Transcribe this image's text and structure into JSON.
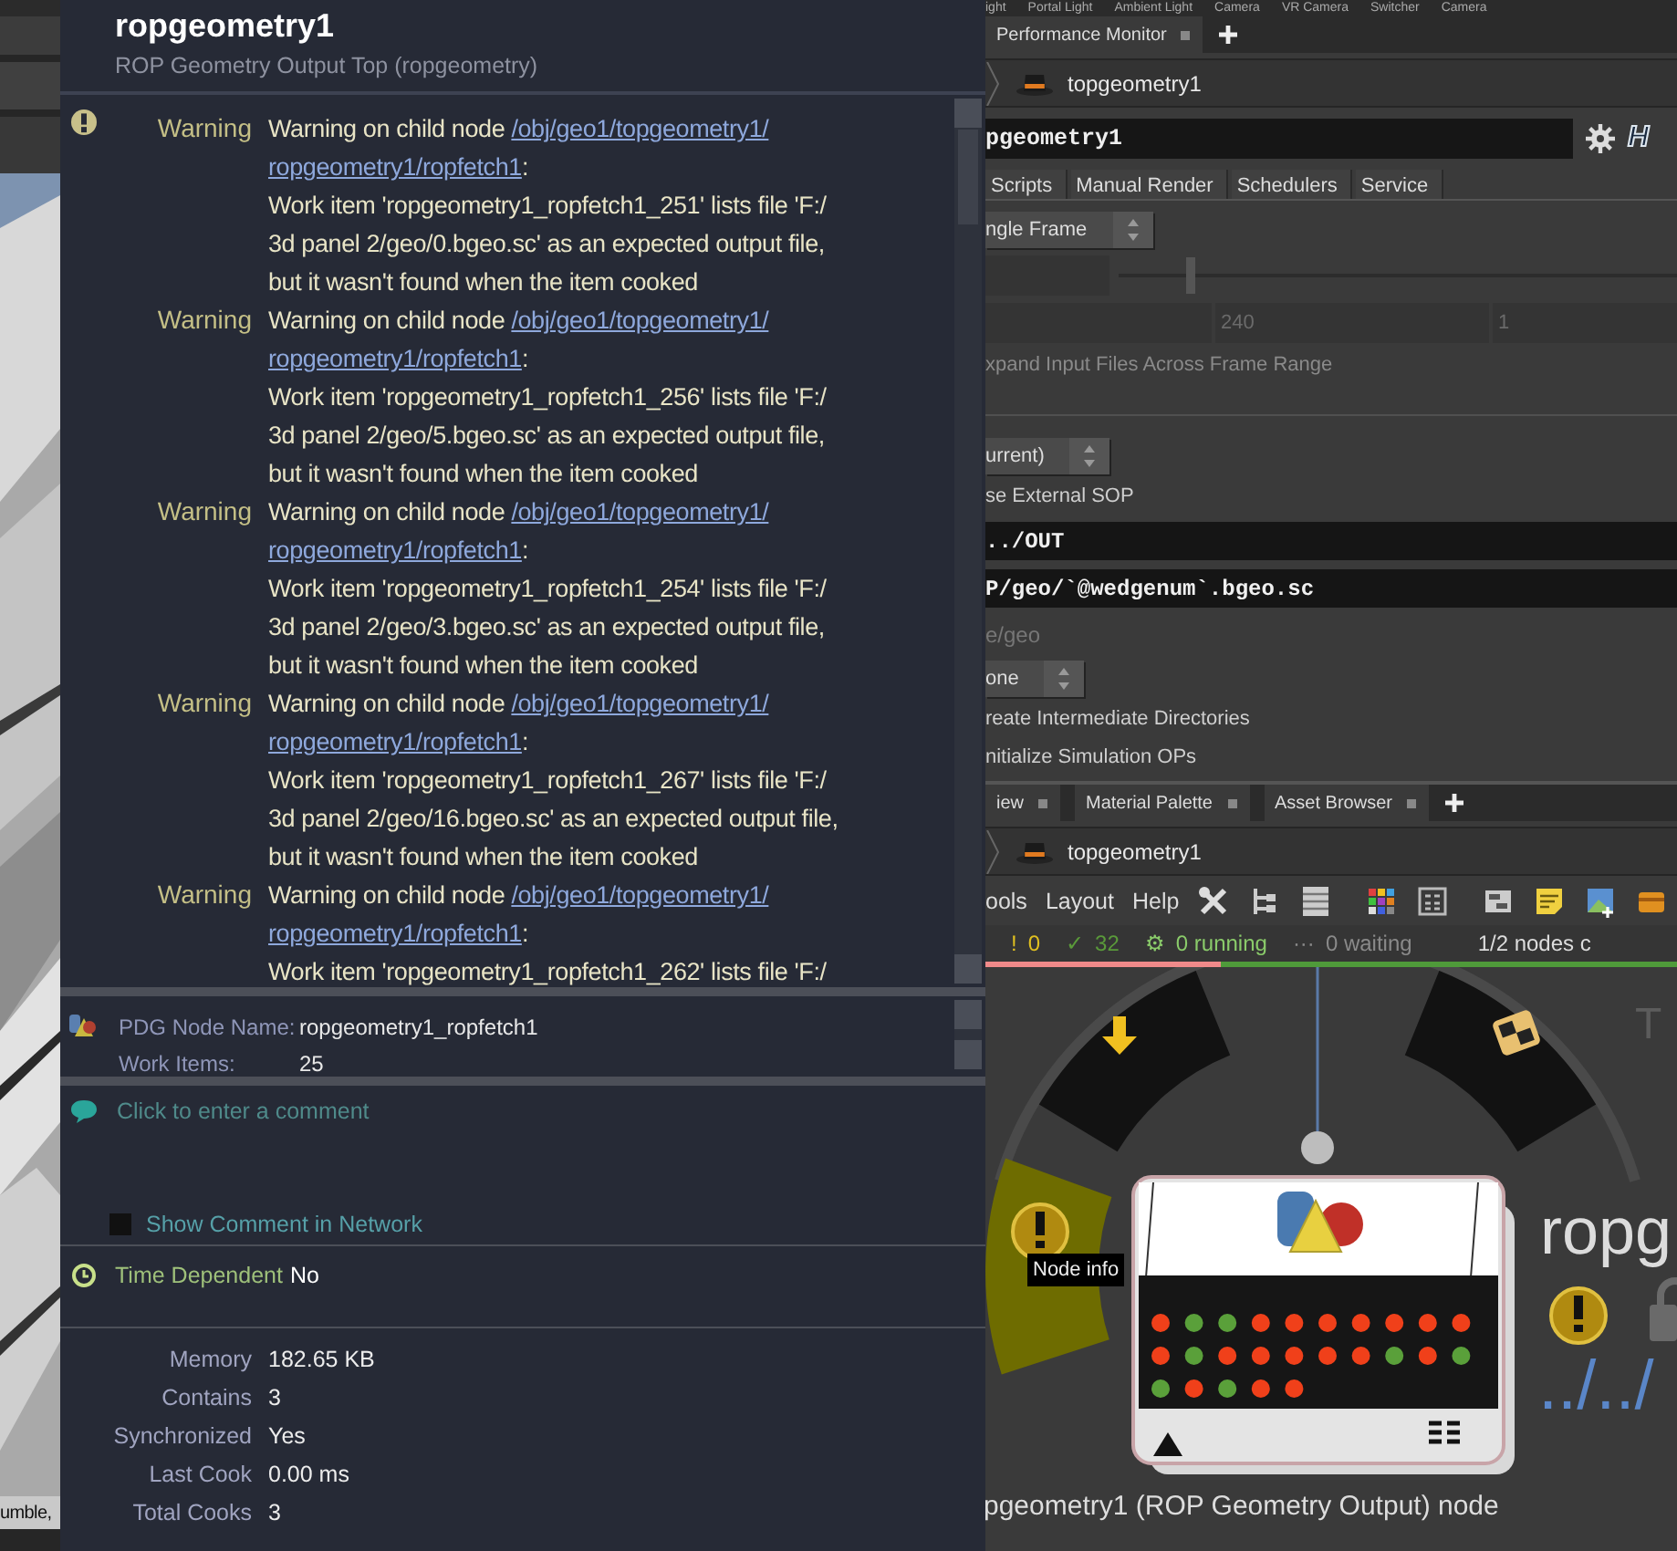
{
  "viewport": {
    "status_text": "umble,"
  },
  "info_panel": {
    "title": "ropgeometry1",
    "subtitle": "ROP Geometry Output Top (ropgeometry)",
    "messages": [
      {
        "kind": "warning",
        "severity": "Warning",
        "prefix": "Warning on child node",
        "link_lines": [
          "/obj/geo1/topgeometry1/",
          "ropgeometry1/ropfetch1"
        ],
        "suffix": ":",
        "body_lines": [
          "Work item 'ropgeometry1_ropfetch1_251' lists file 'F:/",
          "3d panel 2/geo/0.bgeo.sc' as an expected output file,",
          "but it wasn't found when the item cooked"
        ]
      },
      {
        "kind": "warning",
        "severity": "Warning",
        "prefix": "Warning on child node",
        "link_lines": [
          "/obj/geo1/topgeometry1/",
          "ropgeometry1/ropfetch1"
        ],
        "suffix": ":",
        "body_lines": [
          "Work item 'ropgeometry1_ropfetch1_256' lists file 'F:/",
          "3d panel 2/geo/5.bgeo.sc' as an expected output file,",
          "but it wasn't found when the item cooked"
        ]
      },
      {
        "kind": "warning",
        "severity": "Warning",
        "prefix": "Warning on child node",
        "link_lines": [
          "/obj/geo1/topgeometry1/",
          "ropgeometry1/ropfetch1"
        ],
        "suffix": ":",
        "body_lines": [
          "Work item 'ropgeometry1_ropfetch1_254' lists file 'F:/",
          "3d panel 2/geo/3.bgeo.sc' as an expected output file,",
          "but it wasn't found when the item cooked"
        ]
      },
      {
        "kind": "warning",
        "severity": "Warning",
        "prefix": "Warning on child node",
        "link_lines": [
          "/obj/geo1/topgeometry1/",
          "ropgeometry1/ropfetch1"
        ],
        "suffix": ":",
        "body_lines": [
          "Work item 'ropgeometry1_ropfetch1_267' lists file 'F:/",
          "3d panel 2/geo/16.bgeo.sc' as an expected output file,",
          "but it wasn't found when the item cooked"
        ]
      },
      {
        "kind": "warning",
        "severity": "Warning",
        "prefix": "Warning on child node",
        "link_lines": [
          "/obj/geo1/topgeometry1/",
          "ropgeometry1/ropfetch1"
        ],
        "suffix": ":",
        "body_lines": [
          "Work item 'ropgeometry1_ropfetch1_262' lists file 'F:/"
        ]
      }
    ],
    "pdg_fields": [
      {
        "label": "PDG Node Name:",
        "value": "ropgeometry1_ropfetch1"
      },
      {
        "label": "Work Items:",
        "value": "25"
      }
    ],
    "comment": {
      "placeholder": "Click to enter a comment",
      "show_in_network": {
        "label": "Show Comment in Network",
        "checked": false
      }
    },
    "time_dependent": {
      "label": "Time Dependent",
      "value": "No"
    },
    "stats": [
      {
        "label": "Memory",
        "value": "182.65 KB"
      },
      {
        "label": "Contains",
        "value": "3"
      },
      {
        "label": "Synchronized",
        "value": "Yes"
      },
      {
        "label": "Last Cook",
        "value": "0.00 ms"
      },
      {
        "label": "Total Cooks",
        "value": "3"
      }
    ]
  },
  "shelf_labels": [
    "ight",
    "Portal Light",
    "Ambient Light",
    "Camera",
    "VR Camera",
    "Switcher",
    "Camera"
  ],
  "top_tabs": [
    {
      "label": "Performance Monitor"
    }
  ],
  "path": "topgeometry1",
  "parameters": {
    "node_name": "pgeometry1",
    "help_glyph": "H",
    "tabs": [
      "Scripts",
      "Manual Render",
      "Schedulers",
      "Service"
    ],
    "rows": [
      {
        "kind": "dropdown",
        "value": "ngle Frame"
      },
      {
        "kind": "slider",
        "level": 0.12
      },
      {
        "kind": "fields",
        "values": [
          "240",
          "1"
        ]
      },
      {
        "kind": "label",
        "text": "xpand Input Files Across Frame Range",
        "disabled": true
      },
      {
        "kind": "divider"
      },
      {
        "kind": "dropdown",
        "value": "urrent)"
      },
      {
        "kind": "label",
        "text": "se External SOP",
        "disabled": false
      },
      {
        "kind": "text_field",
        "value": "../OUT"
      },
      {
        "kind": "text_field",
        "value": "P/geo/`@wedgenum`.bgeo.sc"
      },
      {
        "kind": "placeholder_field",
        "placeholder": "e/geo"
      },
      {
        "kind": "dropdown",
        "value": "one"
      },
      {
        "kind": "label",
        "text": "reate Intermediate Directories",
        "disabled": false
      },
      {
        "kind": "label",
        "text": "nitialize Simulation OPs",
        "disabled": false
      }
    ]
  },
  "pane_tabs": [
    {
      "label": "iew"
    },
    {
      "label": "Material Palette"
    },
    {
      "label": "Asset Browser"
    }
  ],
  "network": {
    "path": "topgeometry1",
    "menus": [
      "ools",
      "Layout",
      "Help"
    ],
    "status": [
      {
        "kind": "warning",
        "glyph": "!",
        "text": "0"
      },
      {
        "kind": "done",
        "glyph": "✓",
        "text": "32"
      },
      {
        "kind": "running",
        "glyph": "⚙",
        "text": "0 running"
      },
      {
        "kind": "waiting",
        "glyph": "···",
        "text": "0 waiting"
      }
    ],
    "nodes_text": "1/2 nodes c",
    "progress": {
      "level": 0.34
    },
    "corner_text": "T",
    "tooltip": "Node info",
    "node_label": "ropg",
    "node_path": "../../",
    "caption": "pgeometry1 (ROP Geometry Output) node",
    "work_items": [
      {
        "color": "#f0401a"
      },
      {
        "color": "#5aa03a"
      },
      {
        "color": "#5aa03a"
      },
      {
        "color": "#f0401a"
      },
      {
        "color": "#f0401a"
      },
      {
        "color": "#f0401a"
      },
      {
        "color": "#f0401a"
      },
      {
        "color": "#f0401a"
      },
      {
        "color": "#f0401a"
      },
      {
        "color": "#f0401a"
      },
      {
        "color": "#f0401a"
      },
      {
        "color": "#5aa03a"
      },
      {
        "color": "#f0401a"
      },
      {
        "color": "#f0401a"
      },
      {
        "color": "#f0401a"
      },
      {
        "color": "#f0401a"
      },
      {
        "color": "#f0401a"
      },
      {
        "color": "#5aa03a"
      },
      {
        "color": "#f0401a"
      },
      {
        "color": "#5aa03a"
      },
      {
        "color": "#5aa03a"
      },
      {
        "color": "#f0401a"
      },
      {
        "color": "#5aa03a"
      },
      {
        "color": "#f0401a"
      },
      {
        "color": "#f0401a"
      }
    ]
  }
}
